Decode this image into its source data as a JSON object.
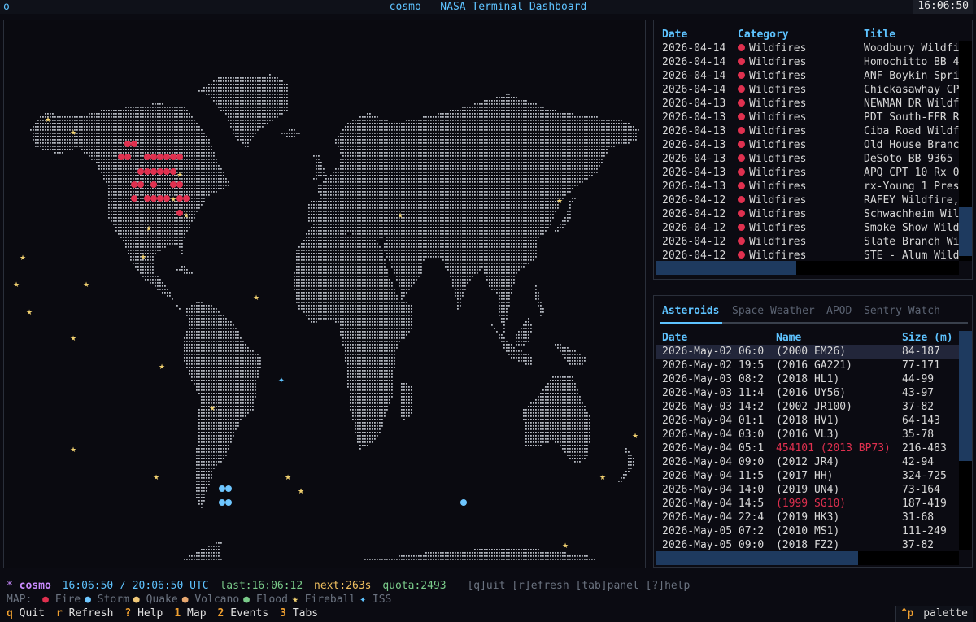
{
  "window": {
    "title": "cosmo — NASA Terminal Dashboard",
    "clock": "16:06:50",
    "icon": "circle-icon"
  },
  "events": {
    "headers": {
      "date": "Date",
      "category": "Category",
      "title": "Title"
    },
    "rows": [
      {
        "date": "2026-04-14",
        "category": "Wildfires",
        "title": "Woodbury Wildfi"
      },
      {
        "date": "2026-04-14",
        "category": "Wildfires",
        "title": "Homochitto BB 4"
      },
      {
        "date": "2026-04-14",
        "category": "Wildfires",
        "title": "ANF Boykin Spri"
      },
      {
        "date": "2026-04-14",
        "category": "Wildfires",
        "title": "Chickasawhay CP"
      },
      {
        "date": "2026-04-13",
        "category": "Wildfires",
        "title": "NEWMAN DR Wildf"
      },
      {
        "date": "2026-04-13",
        "category": "Wildfires",
        "title": "PDT South-FFR R"
      },
      {
        "date": "2026-04-13",
        "category": "Wildfires",
        "title": "Ciba Road Wildf"
      },
      {
        "date": "2026-04-13",
        "category": "Wildfires",
        "title": "Old House Branc"
      },
      {
        "date": "2026-04-13",
        "category": "Wildfires",
        "title": "DeSoto BB 9365"
      },
      {
        "date": "2026-04-13",
        "category": "Wildfires",
        "title": "APQ CPT 10 Rx 0"
      },
      {
        "date": "2026-04-13",
        "category": "Wildfires",
        "title": "rx-Young 1 Pres"
      },
      {
        "date": "2026-04-12",
        "category": "Wildfires",
        "title": "RAFEY Wildfire,"
      },
      {
        "date": "2026-04-12",
        "category": "Wildfires",
        "title": "Schwachheim Wil"
      },
      {
        "date": "2026-04-12",
        "category": "Wildfires",
        "title": "Smoke Show Wild"
      },
      {
        "date": "2026-04-12",
        "category": "Wildfires",
        "title": "Slate Branch Wi"
      },
      {
        "date": "2026-04-12",
        "category": "Wildfires",
        "title": "STE - Alum Wild"
      }
    ]
  },
  "tabs": {
    "items": [
      {
        "label": "Asteroids",
        "active": true
      },
      {
        "label": "Space Weather",
        "active": false
      },
      {
        "label": "APOD",
        "active": false
      },
      {
        "label": "Sentry Watch",
        "active": false
      }
    ]
  },
  "asteroids": {
    "headers": {
      "date": "Date",
      "name": "Name",
      "size": "Size (m)"
    },
    "rows": [
      {
        "date": "2026-May-02 06:0",
        "name": "(2000 EM26)",
        "size": "84-187",
        "hazard": false,
        "selected": true
      },
      {
        "date": "2026-May-02 19:5",
        "name": "(2016 GA221)",
        "size": "77-171",
        "hazard": false
      },
      {
        "date": "2026-May-03 08:2",
        "name": "(2018 HL1)",
        "size": "44-99",
        "hazard": false
      },
      {
        "date": "2026-May-03 11:4",
        "name": "(2016 UY56)",
        "size": "43-97",
        "hazard": false
      },
      {
        "date": "2026-May-03 14:2",
        "name": "(2002 JR100)",
        "size": "37-82",
        "hazard": false
      },
      {
        "date": "2026-May-04 01:1",
        "name": "(2018 HV1)",
        "size": "64-143",
        "hazard": false
      },
      {
        "date": "2026-May-04 03:0",
        "name": "(2016 VL3)",
        "size": "35-78",
        "hazard": false
      },
      {
        "date": "2026-May-04 05:1",
        "name": "454101 (2013 BP73)",
        "size": "216-483",
        "hazard": true
      },
      {
        "date": "2026-May-04 09:0",
        "name": "(2012 JR4)",
        "size": "42-94",
        "hazard": false
      },
      {
        "date": "2026-May-04 11:5",
        "name": "(2017 HH)",
        "size": "324-725",
        "hazard": false
      },
      {
        "date": "2026-May-04 14:0",
        "name": "(2019 UN4)",
        "size": "73-164",
        "hazard": false
      },
      {
        "date": "2026-May-04 14:5",
        "name": "(1999 SG10)",
        "size": "187-419",
        "hazard": true
      },
      {
        "date": "2026-May-04 22:4",
        "name": "(2019 HK3)",
        "size": "31-68",
        "hazard": false
      },
      {
        "date": "2026-May-05 07:2",
        "name": "(2010 MS1)",
        "size": "111-249",
        "hazard": false
      },
      {
        "date": "2026-May-05 09:0",
        "name": "(2018 FZ2)",
        "size": "37-82",
        "hazard": false
      }
    ]
  },
  "status": {
    "app_glyph": "*",
    "app_name": "cosmo",
    "time": "16:06:50 / 20:06:50 UTC",
    "last": "last:16:06:12",
    "next": "next:263s",
    "quota": "quota:2493",
    "keys_hint": "[q]uit [r]efresh [tab]panel [?]help"
  },
  "legend": {
    "label": "MAP:",
    "items": [
      {
        "glyph": "●",
        "label": "Fire",
        "color": "#e0304f"
      },
      {
        "glyph": "●",
        "label": "Storm",
        "color": "#6ec6ff"
      },
      {
        "glyph": "●",
        "label": "Quake",
        "color": "#f0c878"
      },
      {
        "glyph": "●",
        "label": "Volcano",
        "color": "#e8a870"
      },
      {
        "glyph": "●",
        "label": "Flood",
        "color": "#7acb8a"
      },
      {
        "glyph": "★",
        "label": "Fireball",
        "color": "#f0d070"
      },
      {
        "glyph": "✦",
        "label": "ISS",
        "color": "#5ec3ff"
      }
    ]
  },
  "shortcuts": [
    {
      "key": "q",
      "label": "Quit"
    },
    {
      "key": "r",
      "label": "Refresh"
    },
    {
      "key": "?",
      "label": "Help"
    },
    {
      "key": "1",
      "label": "Map"
    },
    {
      "key": "2",
      "label": "Events"
    },
    {
      "key": "3",
      "label": "Tabs"
    }
  ],
  "palette": {
    "key": "^p",
    "label": "palette"
  },
  "colors": {
    "accent": "#5ec3ff",
    "fire": "#e0304f",
    "storm": "#6ec6ff",
    "fireball": "#f0d070",
    "hazard": "#e0304f",
    "key": "#f0a030"
  }
}
